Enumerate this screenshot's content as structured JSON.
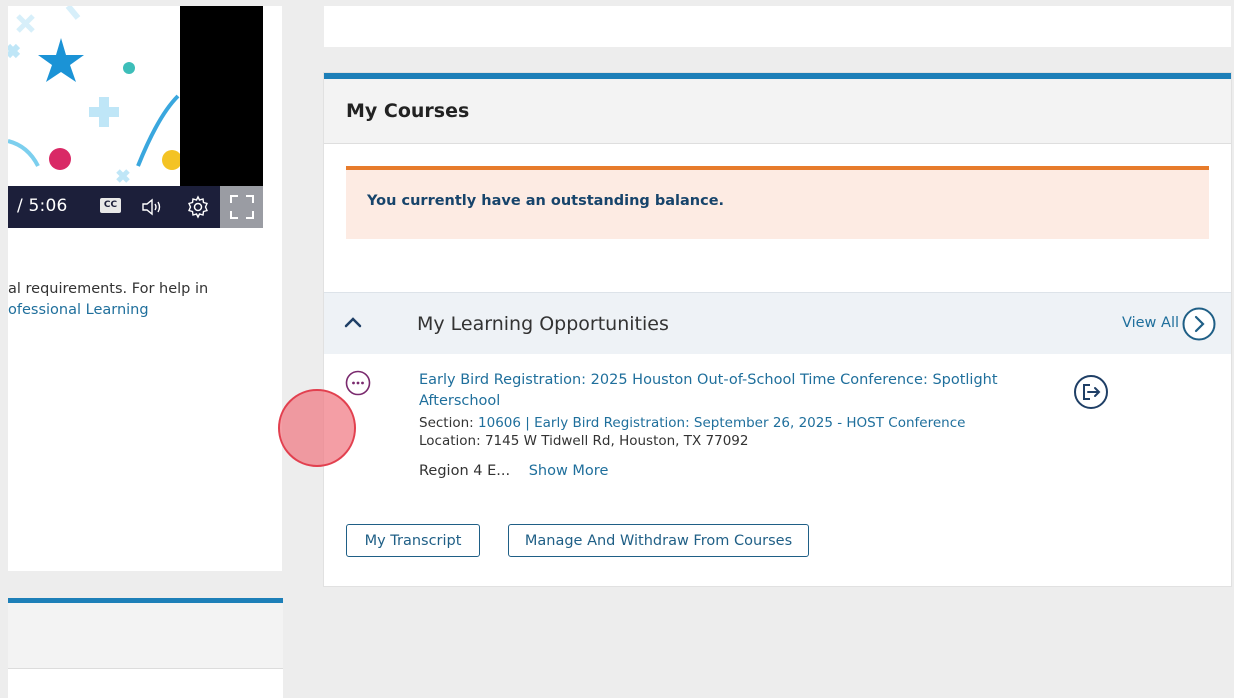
{
  "video": {
    "time_display": "/ 5:06",
    "cc_label": "CC"
  },
  "left_panel": {
    "text_line1": "al requirements. For help in",
    "link_text": "ofessional Learning"
  },
  "courses": {
    "title": "My Courses",
    "alert": "You currently have an outstanding balance.",
    "learning": {
      "title": "My Learning Opportunities",
      "view_all": "View All"
    },
    "course": {
      "title": "Early Bird Registration: 2025 Houston Out-of-School Time Conference: Spotlight Afterschool",
      "section_label": "Section:",
      "section_value": "10606 | Early Bird Registration: September 26, 2025 - HOST Conference",
      "location_label": "Location:",
      "location_value": "7145 W Tidwell Rd, Houston, TX 77092",
      "region_truncated": "Region 4 E...",
      "show_more": "Show More"
    },
    "buttons": {
      "transcript": "My Transcript",
      "manage": "Manage And Withdraw From Courses"
    }
  },
  "colors": {
    "accent_blue": "#1d7fb8",
    "link_blue": "#1f6f9c",
    "alert_border": "#e77b2b",
    "alert_bg": "#fdebe3",
    "more_icon": "#7a2a6e"
  },
  "icons": [
    "closed-captions-icon",
    "volume-icon",
    "settings-gear-icon",
    "fullscreen-icon",
    "chevron-up-icon",
    "chevron-right-circle-icon",
    "more-options-icon",
    "withdraw-exit-icon"
  ]
}
